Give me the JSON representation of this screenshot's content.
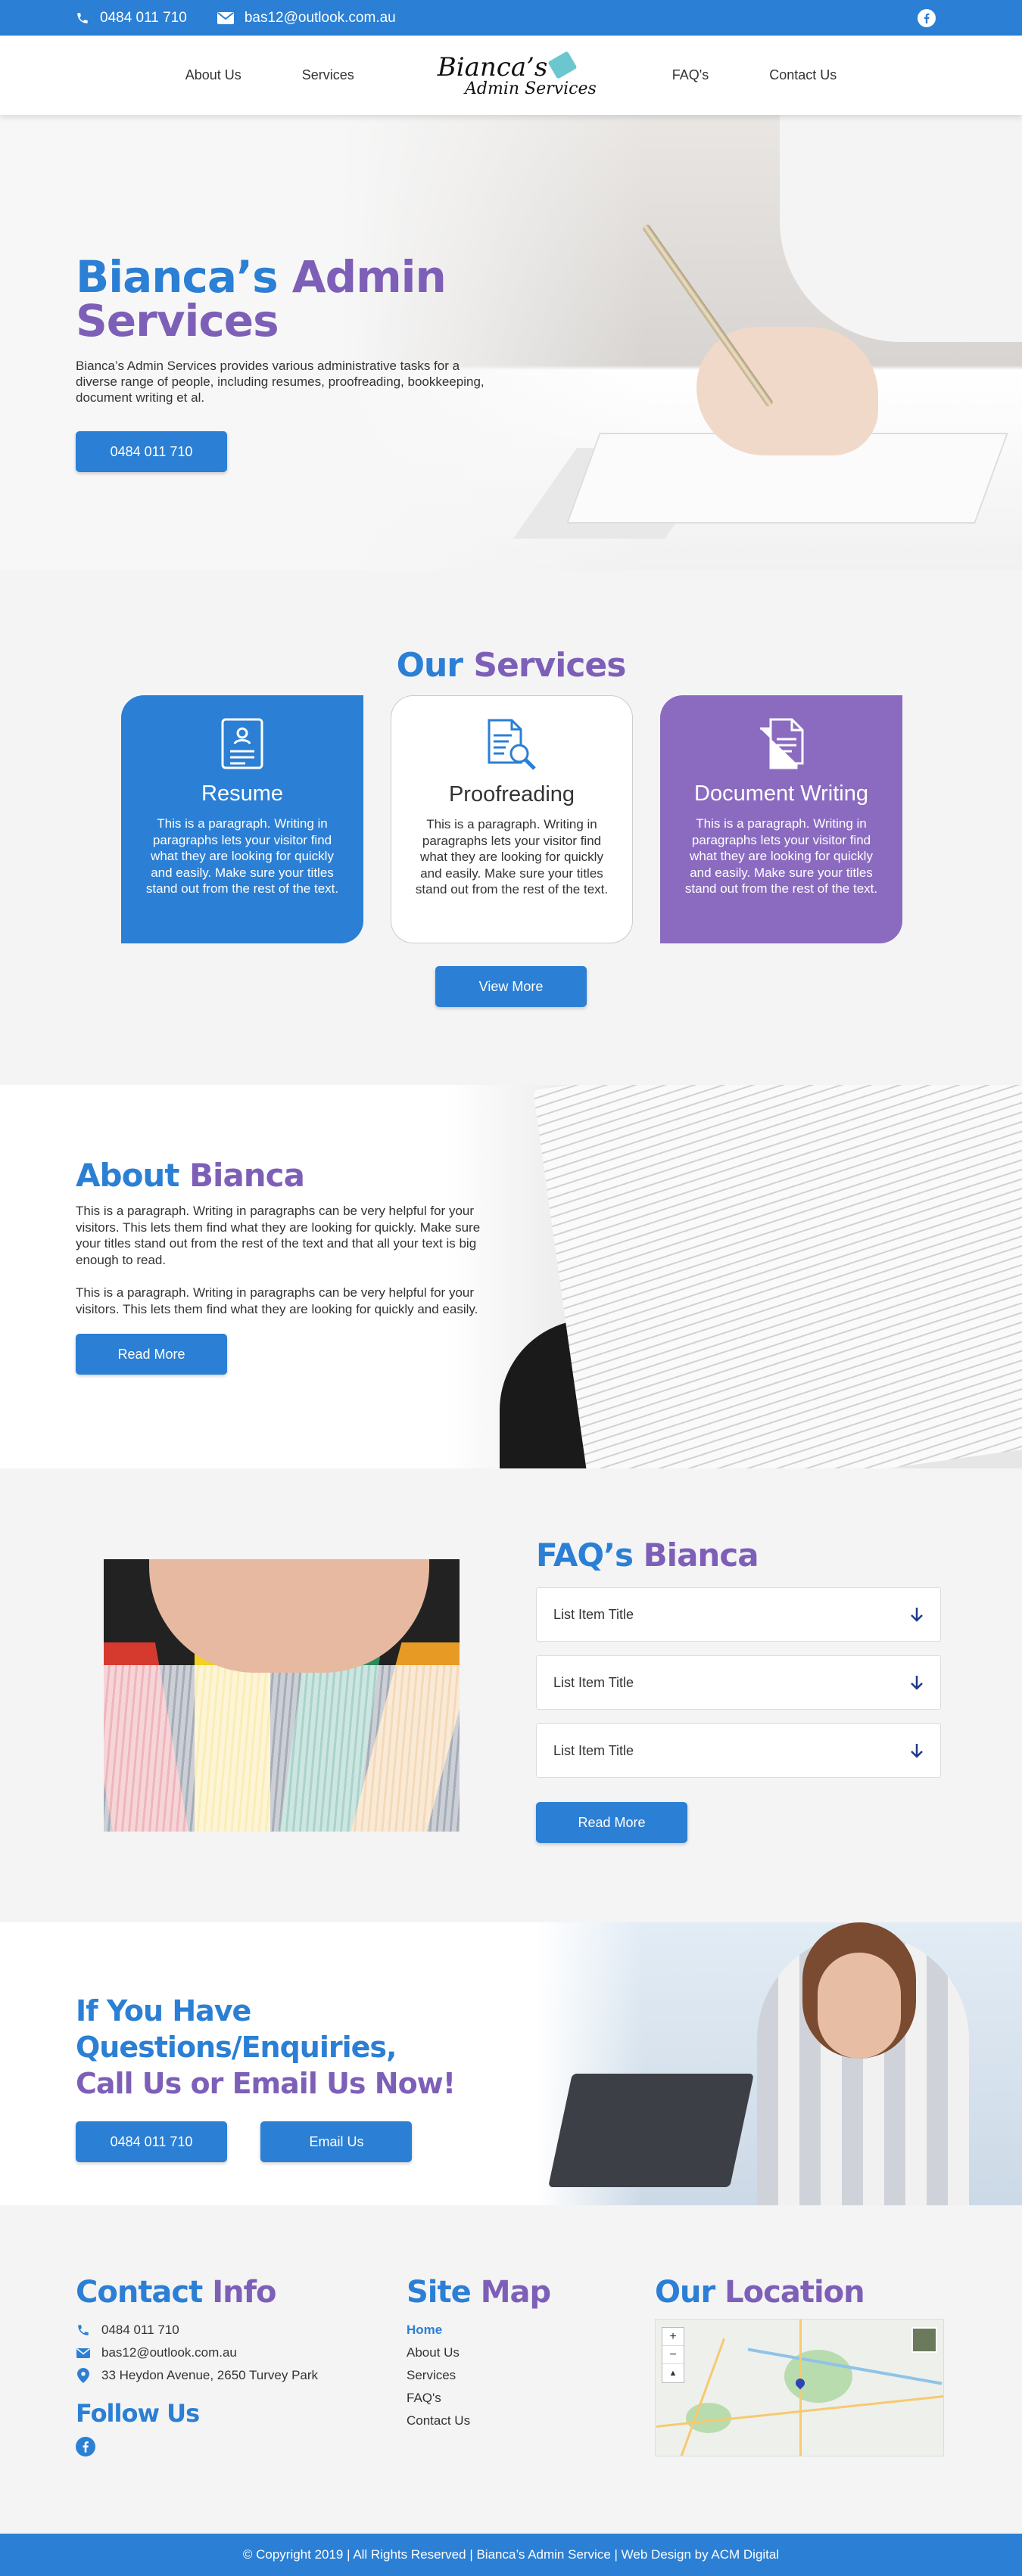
{
  "topbar": {
    "phone": "0484 011 710",
    "email": "bas12@outlook.com.au",
    "facebook_icon": "facebook-icon"
  },
  "nav": {
    "items": [
      "About Us",
      "Services",
      "FAQ's",
      "Contact Us"
    ],
    "logo_line1": "Bianca’s",
    "logo_line2": "Admin Services"
  },
  "hero": {
    "title_part1": "Bianca’s",
    "title_part2": "Admin Services",
    "description": "Bianca’s Admin Services provides various administrative tasks for a diverse range of people, including resumes, proofreading, bookkeeping, document writing et al.",
    "button": "0484 011 710"
  },
  "services": {
    "title_part1": "Our",
    "title_part2": "Services",
    "cards": [
      {
        "title": "Resume",
        "text": "This is a paragraph. Writing in paragraphs lets your visitor find what they are looking for quickly and easily. Make sure your titles stand out from the rest of the text.",
        "icon": "resume-icon"
      },
      {
        "title": "Proofreading",
        "text": "This is a paragraph. Writing in paragraphs lets your visitor find what they are looking for quickly and easily. Make sure your titles stand out from the rest of the text.",
        "icon": "document-search-icon"
      },
      {
        "title": "Document Writing",
        "text": "This is a paragraph. Writing in paragraphs lets your visitor find what they are looking for quickly and easily. Make sure your titles stand out from the rest of the text.",
        "icon": "documents-icon"
      }
    ],
    "button": "View More"
  },
  "about": {
    "title_part1": "About",
    "title_part2": "Bianca",
    "para1": "This is a paragraph. Writing in paragraphs can be very helpful for your visitors. This lets them find what they are looking for quickly. Make sure your titles stand out from the rest of the text and that all your text is big enough to read.",
    "para2": "This is a paragraph. Writing in paragraphs can be very helpful for your visitors. This lets them find what they are looking for quickly and easily.",
    "button": "Read More"
  },
  "faq": {
    "title_part1": "FAQ’s",
    "title_part2": "Bianca",
    "items": [
      "List Item Title",
      "List Item Title",
      "List Item Title"
    ],
    "button": "Read More"
  },
  "enquiry": {
    "line1": "If You Have Questions/Enquiries,",
    "line2": "Call Us or Email Us Now!",
    "phone_button": "0484 011 710",
    "email_button": "Email Us"
  },
  "footer": {
    "contact_title_part1": "Contact",
    "contact_title_part2": "Info",
    "phone": "0484 011 710",
    "email": "bas12@outlook.com.au",
    "address": "33 Heydon Avenue, 2650 Turvey Park",
    "follow_title": "Follow Us",
    "sitemap_title_part1": "Site",
    "sitemap_title_part2": "Map",
    "sitemap": [
      "Home",
      "About Us",
      "Services",
      "FAQ's",
      "Contact Us"
    ],
    "location_title_part1": "Our",
    "location_title_part2": "Location",
    "map_zoom_in": "+",
    "map_zoom_out": "−",
    "map_north": "▲"
  },
  "copyright": "© Copyright 2019 | All Rights Reserved | Bianca’s Admin Service | Web Design by ACM Digital",
  "colors": {
    "primary": "#2b7fd4",
    "accent": "#7d5fb8"
  }
}
